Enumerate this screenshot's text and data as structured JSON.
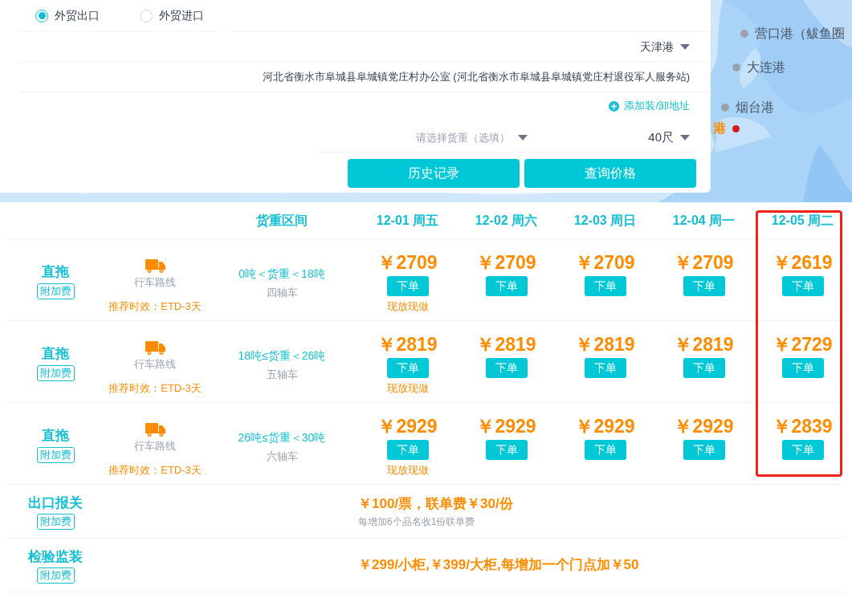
{
  "map_markers": [
    {
      "label": "营口港（鲅鱼圈",
      "kind": "port"
    },
    {
      "label": "大连港",
      "kind": "port"
    },
    {
      "label": "烟台港",
      "kind": "port"
    },
    {
      "label": "港",
      "kind": "current"
    }
  ],
  "trade_type": [
    {
      "label": "外贸出口",
      "selected": true
    },
    {
      "label": "外贸进口",
      "selected": false
    }
  ],
  "port_select": {
    "value": "天津港"
  },
  "address": "河北省衡水市阜城县阜城镇党庄村办公室 (河北省衡水市阜城县阜城镇党庄村退役军人服务站)",
  "add_address_link": "添加装/卸地址",
  "weight_select": {
    "placeholder": "请选择货重（选填）"
  },
  "container_select": {
    "value": "40尺"
  },
  "buttons": [
    "历史记录",
    "查询价格"
  ],
  "table": {
    "weight_header": "货重区间",
    "dates": [
      {
        "label": "12-01 周五",
        "highlighted": false
      },
      {
        "label": "12-02 周六",
        "highlighted": false
      },
      {
        "label": "12-03 周日",
        "highlighted": false
      },
      {
        "label": "12-04 周一",
        "highlighted": false
      },
      {
        "label": "12-05 周二",
        "highlighted": true
      }
    ],
    "rows": [
      {
        "mode": "直拖",
        "surcharge": "附加费",
        "route": "行车路线",
        "eta": "推荐时效：ETD-3天",
        "weight_range": "0吨＜货重＜18吨",
        "truck_type": "四轴车",
        "prices": [
          {
            "price": "￥2709",
            "order": "下单",
            "note": "现放现做"
          },
          {
            "price": "￥2709",
            "order": "下单"
          },
          {
            "price": "￥2709",
            "order": "下单"
          },
          {
            "price": "￥2709",
            "order": "下单"
          },
          {
            "price": "￥2619",
            "order": "下单"
          }
        ]
      },
      {
        "mode": "直拖",
        "surcharge": "附加费",
        "route": "行车路线",
        "eta": "推荐时效：ETD-3天",
        "weight_range": "18吨≤货重＜26吨",
        "truck_type": "五轴车",
        "prices": [
          {
            "price": "￥2819",
            "order": "下单",
            "note": "现放现做"
          },
          {
            "price": "￥2819",
            "order": "下单"
          },
          {
            "price": "￥2819",
            "order": "下单"
          },
          {
            "price": "￥2819",
            "order": "下单"
          },
          {
            "price": "￥2729",
            "order": "下单"
          }
        ]
      },
      {
        "mode": "直拖",
        "surcharge": "附加费",
        "route": "行车路线",
        "eta": "推荐时效：ETD-3天",
        "weight_range": "26吨≤货重＜30吨",
        "truck_type": "六轴车",
        "prices": [
          {
            "price": "￥2929",
            "order": "下单",
            "note": "现放现做"
          },
          {
            "price": "￥2929",
            "order": "下单"
          },
          {
            "price": "￥2929",
            "order": "下单"
          },
          {
            "price": "￥2929",
            "order": "下单"
          },
          {
            "price": "￥2839",
            "order": "下单"
          }
        ]
      }
    ]
  },
  "extra_fees": [
    {
      "name": "出口报关",
      "surcharge": "附加费",
      "price": "￥100/票，联单费￥30/份",
      "note": "每增加6个品名收1份联单费"
    },
    {
      "name": "检验监装",
      "surcharge": "附加费",
      "price": "￥299/小柜,￥399/大柜,每增加一个门点加￥50"
    }
  ]
}
